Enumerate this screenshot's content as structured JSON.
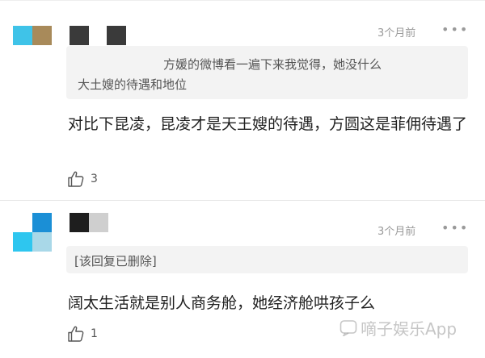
{
  "comments": [
    {
      "time": "3个月前",
      "more": "•••",
      "quote_line1": "方媛的微博看一遍下来我觉得，她没什么",
      "quote_line2": "大土嫂的待遇和地位",
      "text": "对比下昆凌，昆凌才是天王嫂的待遇，方圆这是菲佣待遇了",
      "likes": "3",
      "avatar_colors": [
        "#3fc3e8",
        "#a88a5a"
      ],
      "name_colors": [
        "#3a3a3a",
        "#3a3a3a"
      ]
    },
    {
      "time": "3个月前",
      "more": "•••",
      "quote_deleted": "[该回复已删除]",
      "text": "阔太生活就是别人商务舱，她经济舱哄孩子么",
      "likes": "1",
      "avatar_colors": [
        "#ffffff",
        "#1b8fd6",
        "#2ec6ef",
        "#a9d8e8"
      ],
      "name_colors": [
        "#1e1e1e",
        "#cfcfcf"
      ]
    }
  ],
  "watermark": "嘀子娱乐App",
  "icons": {
    "like": "thumbs-up-icon",
    "more": "more-dots-icon",
    "watermark": "brand-logo-icon"
  }
}
